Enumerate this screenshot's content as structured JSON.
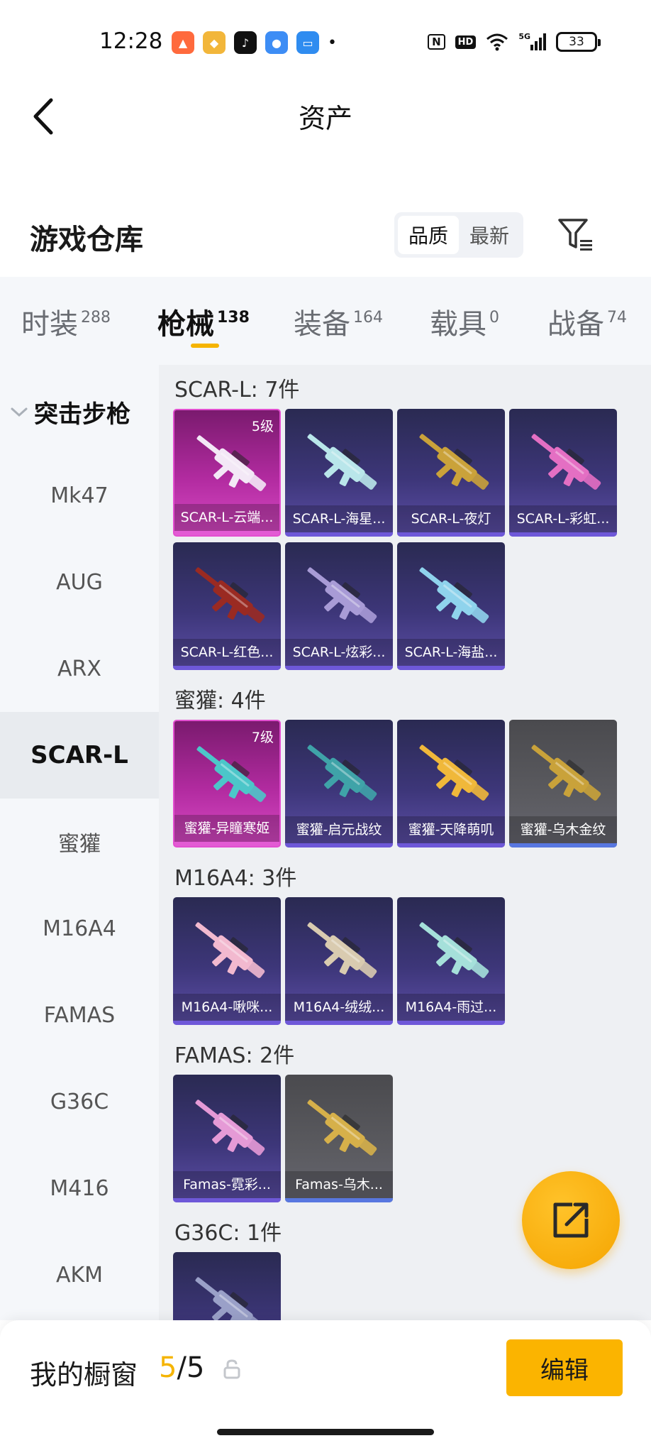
{
  "status_bar": {
    "time": "12:28",
    "battery": "33",
    "network_label": "5G",
    "hd_label": "HD",
    "nfc_label": "N",
    "apps": [
      "game-icon",
      "app-icon",
      "tiktok-icon",
      "cloud-icon",
      "calendar-icon"
    ]
  },
  "header": {
    "title": "资产"
  },
  "warehouse": {
    "title": "游戏仓库",
    "sort_options": [
      "品质",
      "最新"
    ],
    "active_sort": 0
  },
  "tabs": [
    {
      "label": "时装",
      "count": "288"
    },
    {
      "label": "枪械",
      "count": "138"
    },
    {
      "label": "装备",
      "count": "164"
    },
    {
      "label": "载具",
      "count": "0"
    },
    {
      "label": "战备",
      "count": "74"
    }
  ],
  "active_tab": 1,
  "sidebar": {
    "group": "突击步枪",
    "items": [
      "Mk47",
      "AUG",
      "ARX",
      "SCAR-L",
      "蜜獾",
      "M16A4",
      "FAMAS",
      "G36C",
      "M416",
      "AKM"
    ],
    "active": 3
  },
  "sections": [
    {
      "title": "SCAR-L: 7件",
      "items": [
        {
          "name": "SCAR-L-云端...",
          "level": "5级",
          "rarity": "pink",
          "gun_color": "#f3e8f6"
        },
        {
          "name": "SCAR-L-海星...",
          "rarity": "purple",
          "gun_color": "#b9e6ea"
        },
        {
          "name": "SCAR-L-夜灯",
          "rarity": "purple",
          "gun_color": "#caa23a"
        },
        {
          "name": "SCAR-L-彩虹...",
          "rarity": "purple",
          "gun_color": "#e46fc3"
        },
        {
          "name": "SCAR-L-红色...",
          "rarity": "purple",
          "gun_color": "#9a2a22"
        },
        {
          "name": "SCAR-L-炫彩...",
          "rarity": "purple",
          "gun_color": "#a89bd6"
        },
        {
          "name": "SCAR-L-海盐...",
          "rarity": "purple",
          "gun_color": "#8fd3ec"
        }
      ]
    },
    {
      "title": "蜜獾: 4件",
      "items": [
        {
          "name": "蜜獾-异瞳寒姬",
          "level": "7级",
          "rarity": "pink",
          "gun_color": "#4cc6c9"
        },
        {
          "name": "蜜獾-启元战纹",
          "rarity": "purple",
          "gun_color": "#3fa3a8"
        },
        {
          "name": "蜜獾-天降萌叽",
          "rarity": "purple",
          "gun_color": "#f0b83a"
        },
        {
          "name": "蜜獾-乌木金纹",
          "rarity": "gray",
          "gun_color": "#c9a23a"
        }
      ]
    },
    {
      "title": "M16A4: 3件",
      "items": [
        {
          "name": "M16A4-啾咪...",
          "rarity": "purple",
          "gun_color": "#f2b9cf"
        },
        {
          "name": "M16A4-绒绒...",
          "rarity": "purple",
          "gun_color": "#d9cbb0"
        },
        {
          "name": "M16A4-雨过...",
          "rarity": "purple",
          "gun_color": "#a5e0da"
        }
      ]
    },
    {
      "title": "FAMAS: 2件",
      "items": [
        {
          "name": "Famas-霓彩...",
          "rarity": "purple",
          "gun_color": "#e59ad6"
        },
        {
          "name": "Famas-乌木...",
          "rarity": "gray",
          "gun_color": "#d6b04a"
        }
      ]
    },
    {
      "title": "G36C: 1件",
      "items": [
        {
          "name": "",
          "rarity": "purple",
          "gun_color": "#9aa0c8"
        }
      ]
    }
  ],
  "showcase": {
    "label": "我的橱窗",
    "current": "5",
    "separator": "/",
    "total": "5",
    "edit_label": "编辑"
  },
  "colors": {
    "accent": "#f5b400",
    "card_purple": "#3d3679",
    "card_pink": "#b22ba0",
    "card_gray": "#5b5b60"
  }
}
